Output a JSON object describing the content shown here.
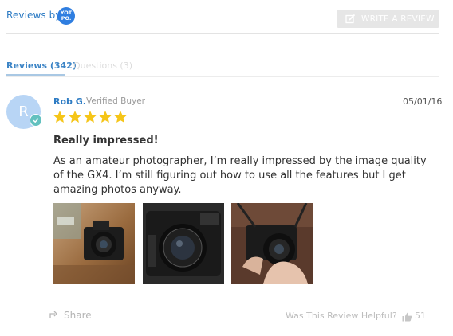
{
  "header": {
    "reviews_by": "Reviews by",
    "logo_text_line1": "YOT",
    "logo_text_line2": "PO.",
    "write_review_label": "WRITE A REVIEW"
  },
  "tabs": [
    {
      "label": "Reviews (342)",
      "active": true
    },
    {
      "label": "Questions (3)",
      "active": false
    }
  ],
  "review": {
    "avatar_initial": "R",
    "author": "Rob G.",
    "badge": "Verified Buyer",
    "date": "05/01/16",
    "rating": 5,
    "max_rating": 5,
    "title": "Really impressed!",
    "body": "As an amateur photographer, I’m really impressed by the image quality of the GX4. I’m still figuring out how to use all the features but I get amazing photos anyway.",
    "photos": [
      {
        "name": "camera-on-table-photo"
      },
      {
        "name": "camera-front-closeup-photo"
      },
      {
        "name": "camera-in-hands-photo"
      }
    ],
    "share_label": "Share",
    "helpful_label": "Was This Review Helpful?",
    "helpful_count": "51"
  },
  "colors": {
    "accent": "#2e7cc4",
    "star": "#f5c518",
    "avatar_bg": "#b8d5f5",
    "verified": "#63c1bf"
  }
}
